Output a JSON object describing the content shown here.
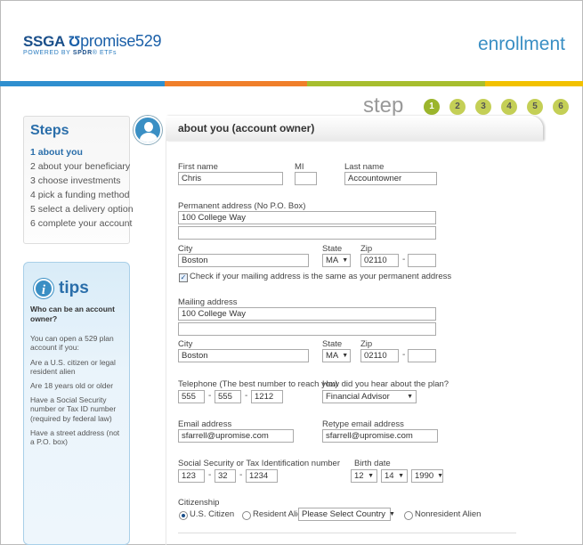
{
  "header": {
    "logo_ssga": "SSGA",
    "logo_u": "Ʊ",
    "logo_promise": "promise529",
    "logo_powered": "POWERED BY",
    "logo_spdr": "SPDR",
    "logo_etfs": "® ETFs",
    "enrollment": "enrollment"
  },
  "colors": {
    "bar": [
      "#2f8fcf",
      "#f07f2a",
      "#a7be2e",
      "#f2c100"
    ],
    "accent": "#2a6eaa",
    "step_active": "#9bb52c",
    "step_inactive": "#c4cf56"
  },
  "progress": {
    "label": "step",
    "steps": [
      "1",
      "2",
      "3",
      "4",
      "5",
      "6"
    ],
    "current": 1
  },
  "sidebar": {
    "title": "Steps",
    "items": [
      {
        "label": "1  about you"
      },
      {
        "label": "2  about your beneficiary"
      },
      {
        "label": "3  choose investments"
      },
      {
        "label": "4  pick a funding method"
      },
      {
        "label": "5  select a delivery option"
      },
      {
        "label": "6  complete your account"
      }
    ]
  },
  "tips": {
    "icon": "info-icon",
    "icon_glyph": "i",
    "title": "tips",
    "question": "Who can be an account owner?",
    "paragraphs": [
      "You can open a 529 plan account if you:",
      "Are a U.S. citizen or legal resident alien",
      "Are 18 years old or older",
      "Have a Social Security number or Tax ID number (required by federal law)",
      "Have a street address (not a P.O. box)"
    ]
  },
  "form": {
    "section_title": "about you (account owner)",
    "first_name": {
      "label": "First name",
      "value": "Chris"
    },
    "mi": {
      "label": "MI",
      "value": ""
    },
    "last_name": {
      "label": "Last name",
      "value": "Accountowner"
    },
    "perm_address": {
      "label": "Permanent address (No P.O. Box)",
      "line1": "100 College Way",
      "line2": ""
    },
    "perm_city": {
      "label": "City",
      "value": "Boston"
    },
    "perm_state": {
      "label": "State",
      "value": "MA"
    },
    "perm_zip": {
      "label": "Zip",
      "value": "02110",
      "ext": ""
    },
    "same_address": {
      "label": "Check if your mailing address is the same as your permanent address",
      "checked": true,
      "mark": "✓"
    },
    "mail_address": {
      "label": "Mailing address",
      "line1": "100 College Way",
      "line2": ""
    },
    "mail_city": {
      "label": "City",
      "value": "Boston"
    },
    "mail_state": {
      "label": "State",
      "value": "MA"
    },
    "mail_zip": {
      "label": "Zip",
      "value": "02110",
      "ext": ""
    },
    "telephone": {
      "label": "Telephone (The best number to reach you)",
      "p1": "555",
      "p2": "555",
      "p3": "1212"
    },
    "hear_about": {
      "label": "How did you hear about the plan?",
      "value": "Financial Advisor"
    },
    "email": {
      "label": "Email address",
      "value": "sfarrell@upromise.com"
    },
    "retype_email": {
      "label": "Retype email address",
      "value": "sfarrell@upromise.com"
    },
    "ssn": {
      "label": "Social Security or Tax Identification number",
      "p1": "123",
      "p2": "32",
      "p3": "1234"
    },
    "birth_date": {
      "label": "Birth date",
      "month": "12",
      "day": "14",
      "year": "1990"
    },
    "citizenship": {
      "label": "Citizenship",
      "us_citizen": "U.S. Citizen",
      "resident_alien": "Resident Alien",
      "country_placeholder": "Please Select Country",
      "nonresident_alien": "Nonresident Alien",
      "selected": "U.S. Citizen"
    },
    "dash": "-",
    "dropdown_arrow": "▼"
  }
}
